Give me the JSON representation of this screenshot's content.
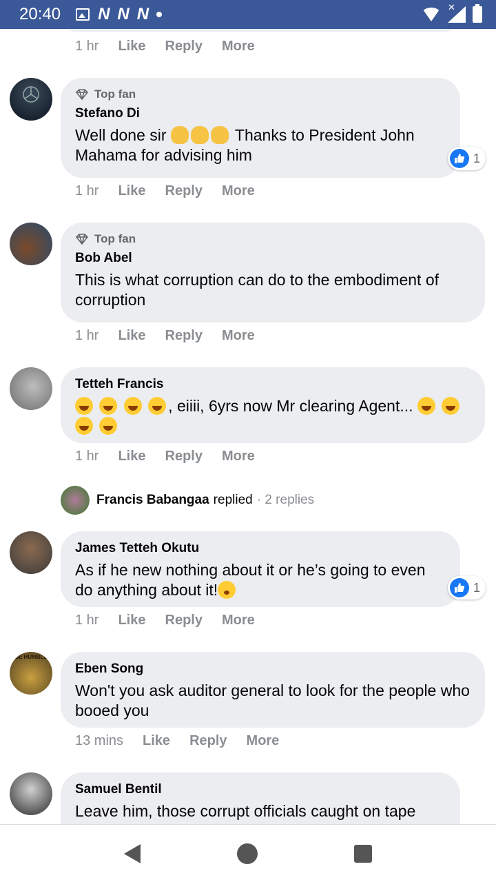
{
  "status_bar": {
    "time": "20:40",
    "notif_icons": [
      "N",
      "N",
      "N"
    ]
  },
  "actions_labels": {
    "like": "Like",
    "reply": "Reply",
    "more": "More"
  },
  "top_fan_label": "Top fan",
  "partial_top": {
    "time": "1 hr"
  },
  "comments": [
    {
      "name": "Stefano Di",
      "top_fan": true,
      "text1": "Well done sir",
      "text2": "Thanks to President John Mahama for advising him",
      "time": "1 hr",
      "likes": "1"
    },
    {
      "name": "Bob Abel",
      "top_fan": true,
      "text": "This is what corruption can do to the embodiment of corruption",
      "time": "1 hr"
    },
    {
      "name": "Tetteh Francis",
      "text": ", eiiii, 6yrs now Mr clearing Agent...",
      "time": "1 hr"
    },
    {
      "name": "James Tetteh Okutu",
      "text": "As if he new nothing about it or he’s going to even do anything about it!",
      "time": "1 hr",
      "likes": "1"
    },
    {
      "name": "Eben Song",
      "text": "Won't you ask auditor general to look for the people who booed you",
      "time": "13 mins"
    },
    {
      "name": "Samuel Bentil",
      "text": "Leave him, those corrupt officials caught on tape"
    }
  ],
  "reply_summary": {
    "name": "Francis Babangaa",
    "verb": "replied",
    "count": "2 replies"
  },
  "avatar_texts": {
    "eben": "BE HUMBLE"
  }
}
